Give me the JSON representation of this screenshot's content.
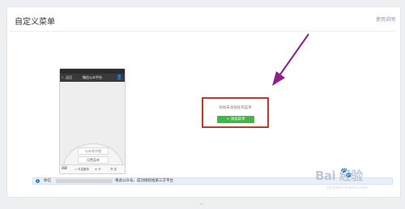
{
  "page": {
    "title": "自定义菜单",
    "help_link": "使用说明"
  },
  "phone": {
    "back_label": "返回",
    "header_title": "微信公众平台",
    "menu_items": [
      "公众号介绍",
      "设置菜单"
    ],
    "bottom_tabs": [
      "= 丰富服务",
      "≡ 卡",
      "开 支"
    ]
  },
  "empty_state": {
    "hint": "你尚未添加任何菜单",
    "add_button_label": "+ 添加菜单"
  },
  "info_bar": {
    "prefix": "你已",
    "suffix": "将此公众号，成功授权给第三方平台"
  },
  "watermark": {
    "brand": "Bai  经验",
    "url": "jingyan.baidu.com"
  },
  "page_indicator": "—",
  "colors": {
    "primary_green": "#44b549",
    "highlight_red": "#c0392b",
    "arrow_purple": "#8e1f8c",
    "info_blue": "#2f7ce0"
  }
}
